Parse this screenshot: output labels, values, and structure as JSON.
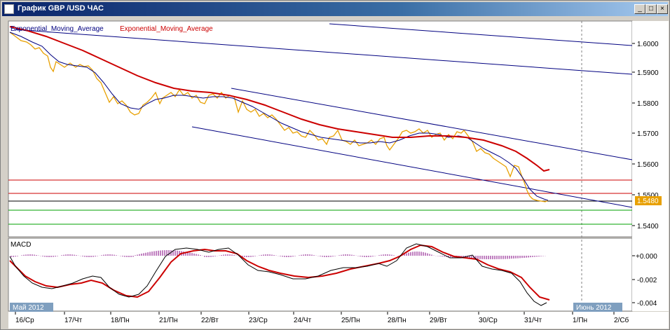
{
  "window": {
    "title": "График GBP /USD  ЧАС",
    "minimize_glyph": "_",
    "restore_glyph": "□",
    "close_glyph": "×"
  },
  "main_chart": {
    "legend_ema_1": "Exponential_Moving_Average",
    "legend_ema_2": "Exponential_Moving_Average",
    "legend_color_1": "#000080",
    "legend_color_2": "#cc0000",
    "price_color": "#e8a000",
    "current_price_label": "1.5480",
    "y_ticks": [
      "1.6000",
      "1.5900",
      "1.5800",
      "1.5700",
      "1.5600",
      "1.5500",
      "1.5400"
    ]
  },
  "macd_panel": {
    "label": "MACD",
    "y_ticks": [
      "+0.000",
      "-0.002",
      "-0.004"
    ]
  },
  "x_axis": {
    "ticks": [
      "16/Ср",
      "17/Чт",
      "18/Пн",
      "21/Пн",
      "22/Вт",
      "23/Ср",
      "24/Чт",
      "25/Пн",
      "28/Пн",
      "29/Вт",
      "30/Ср",
      "31/Чт",
      "1/Пн",
      "2/Сб"
    ],
    "month_label_left": "Май 2012",
    "month_label_right": "Июнь 2012"
  }
}
